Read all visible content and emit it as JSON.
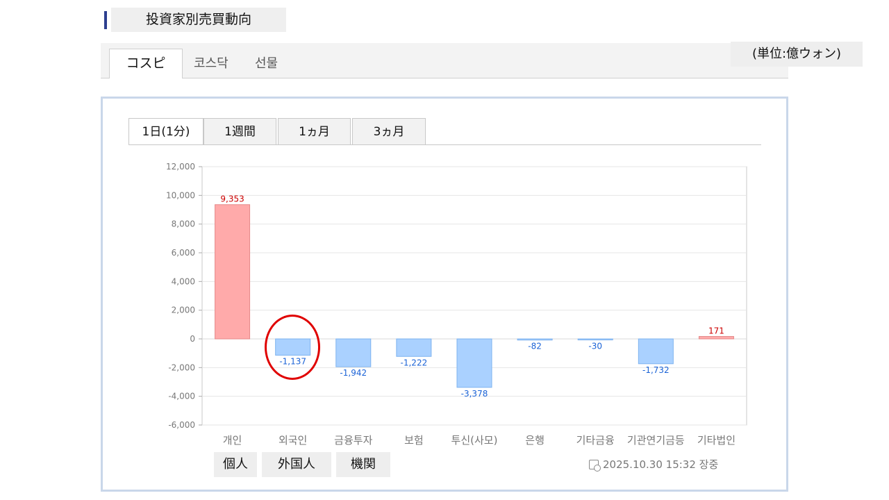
{
  "section_title": "投資家別売買動向",
  "market_tabs": [
    "コスピ",
    "코스닥",
    "선물"
  ],
  "unit": "(単位:億ウォン)",
  "period_tabs": [
    "1日(1分)",
    "1週間",
    "1ヵ月",
    "3ヵ月"
  ],
  "category_tags": [
    "個人",
    "外国人",
    "機関"
  ],
  "timestamp": "2025.10.30 15:32 장중",
  "colors": {
    "positive": "#ffaaaa",
    "negative": "#aad1ff",
    "positive_text": "#cc0000",
    "negative_text": "#1a62d6",
    "annotation": "#e00000"
  },
  "chart_data": {
    "type": "bar",
    "categories": [
      "개인",
      "외국인",
      "금융투자",
      "보험",
      "투신(사모)",
      "은행",
      "기타금융",
      "기관연기금등",
      "기타법인"
    ],
    "values": [
      9353,
      -1137,
      -1942,
      -1222,
      -3378,
      -82,
      -30,
      -1732,
      171
    ],
    "value_labels": [
      "9,353",
      "-1,137",
      "-1,942",
      "-1,222",
      "-3,378",
      "-82",
      "-30",
      "-1,732",
      "171"
    ],
    "ylim": [
      -6000,
      12000
    ],
    "yticks": [
      12000,
      10000,
      8000,
      6000,
      4000,
      2000,
      0,
      -2000,
      -4000,
      -6000
    ],
    "ytick_labels": [
      "12,000",
      "10,000",
      "8,000",
      "6,000",
      "4,000",
      "2,000",
      "0",
      "-2,000",
      "-4,000",
      "-6,000"
    ],
    "grid": true
  }
}
